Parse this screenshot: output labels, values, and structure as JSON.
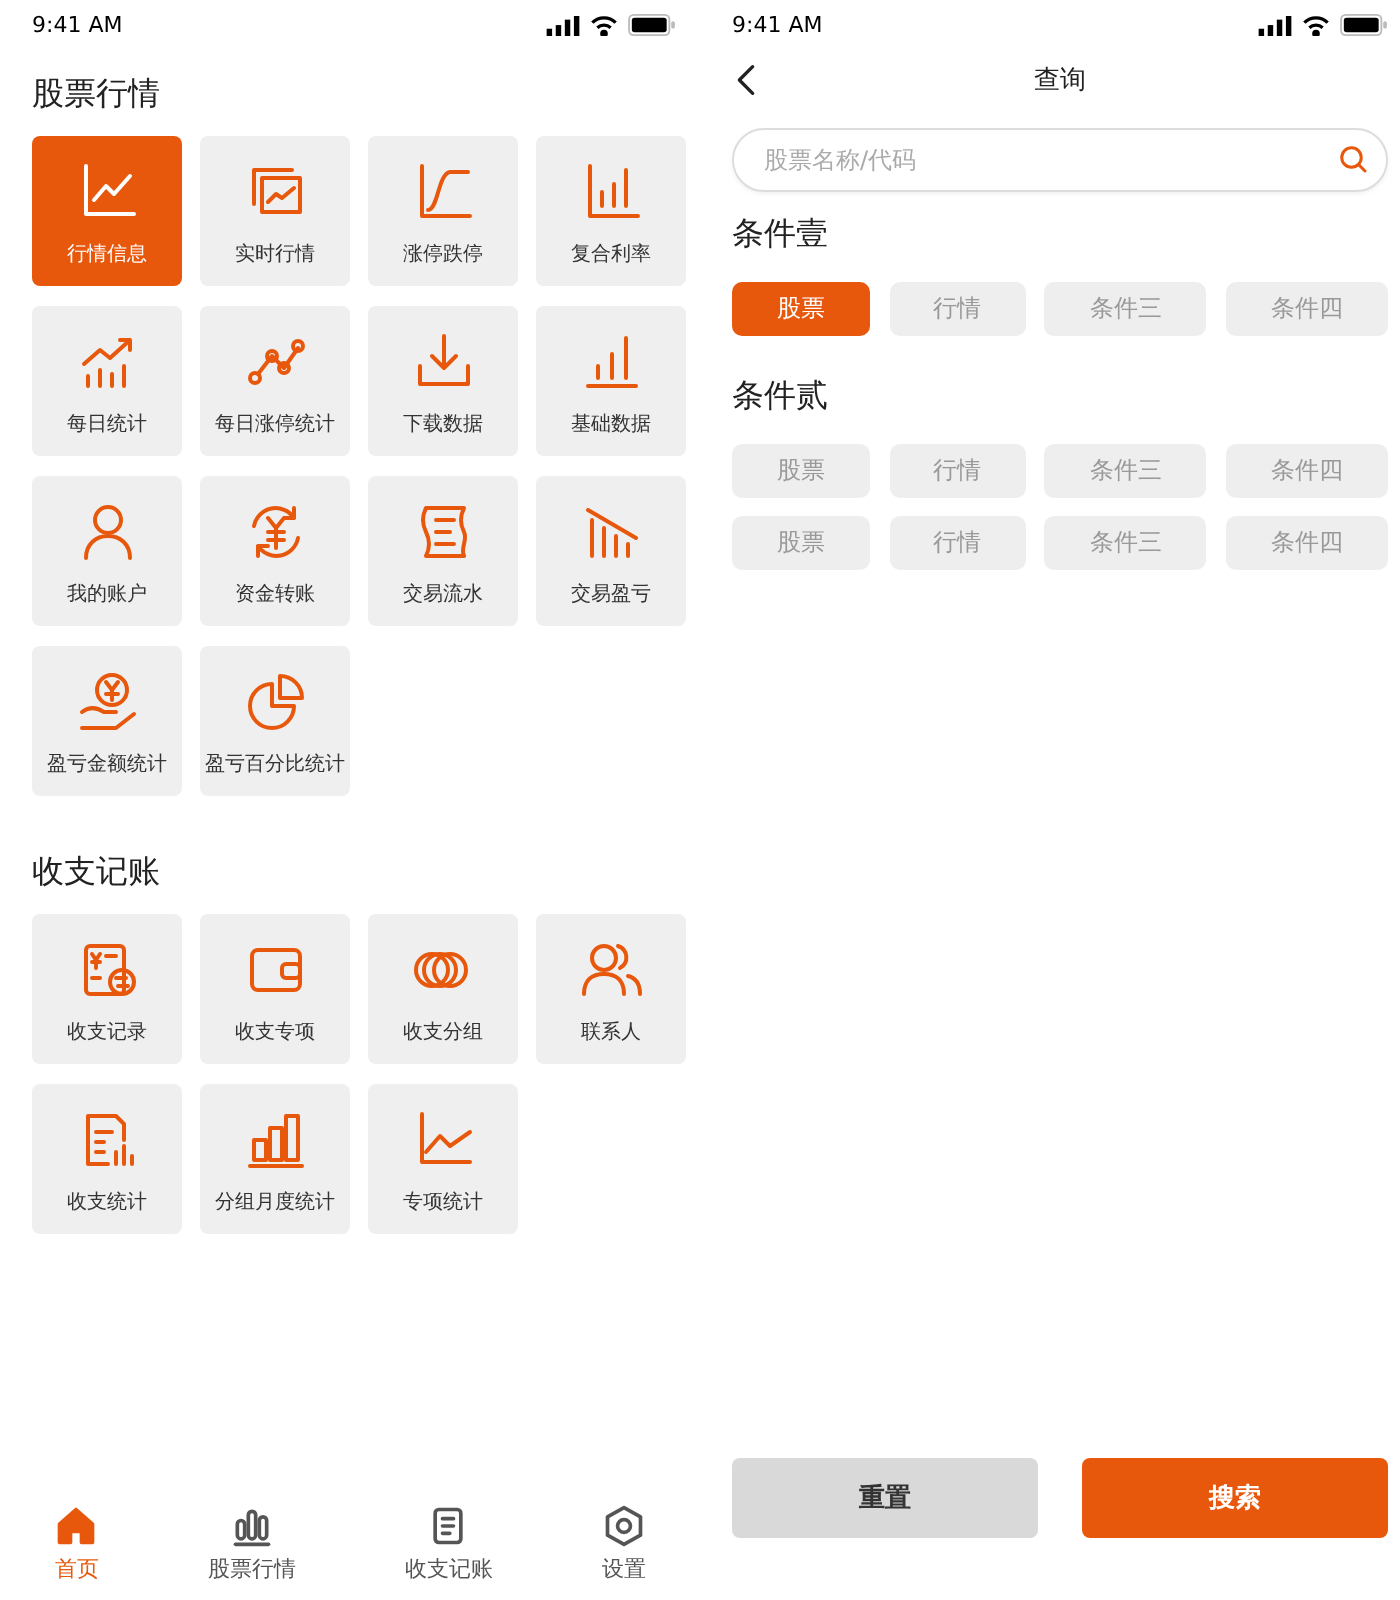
{
  "home": {
    "status_bar": {
      "time": "9:41 AM"
    },
    "sections": [
      {
        "title": "股票行情",
        "tiles": [
          {
            "label": "行情信息",
            "selected": true
          },
          {
            "label": "实时行情",
            "selected": false
          },
          {
            "label": "涨停跌停",
            "selected": false
          },
          {
            "label": "复合利率",
            "selected": false
          },
          {
            "label": "每日统计",
            "selected": false
          },
          {
            "label": "每日涨停统计",
            "selected": false
          },
          {
            "label": "下载数据",
            "selected": false
          },
          {
            "label": "基础数据",
            "selected": false
          },
          {
            "label": "我的账户",
            "selected": false
          },
          {
            "label": "资金转账",
            "selected": false
          },
          {
            "label": "交易流水",
            "selected": false
          },
          {
            "label": "交易盈亏",
            "selected": false
          },
          {
            "label": "盈亏金额统计",
            "selected": false
          },
          {
            "label": "盈亏百分比统计",
            "selected": false
          }
        ]
      },
      {
        "title": "收支记账",
        "tiles": [
          {
            "label": "收支记录",
            "selected": false
          },
          {
            "label": "收支专项",
            "selected": false
          },
          {
            "label": "收支分组",
            "selected": false
          },
          {
            "label": "联系人",
            "selected": false
          },
          {
            "label": "收支统计",
            "selected": false
          },
          {
            "label": "分组月度统计",
            "selected": false
          },
          {
            "label": "专项统计",
            "selected": false
          }
        ]
      }
    ],
    "tab_bar": [
      {
        "label": "首页",
        "selected": true
      },
      {
        "label": "股票行情",
        "selected": false
      },
      {
        "label": "收支记账",
        "selected": false
      },
      {
        "label": "设置",
        "selected": false
      }
    ]
  },
  "query": {
    "status_bar": {
      "time": "9:41 AM"
    },
    "title": "查询",
    "search": {
      "placeholder": "股票名称/代码"
    },
    "groups": [
      {
        "title": "条件壹",
        "rows": [
          {
            "chips": [
              {
                "label": "股票",
                "selected": true
              },
              {
                "label": "行情",
                "selected": false
              },
              {
                "label": "条件三",
                "selected": false
              },
              {
                "label": "条件四",
                "selected": false
              }
            ]
          }
        ]
      },
      {
        "title": "条件贰",
        "rows": [
          {
            "chips": [
              {
                "label": "股票",
                "selected": false
              },
              {
                "label": "行情",
                "selected": false
              },
              {
                "label": "条件三",
                "selected": false
              },
              {
                "label": "条件四",
                "selected": false
              }
            ]
          },
          {
            "chips": [
              {
                "label": "股票",
                "selected": false
              },
              {
                "label": "行情",
                "selected": false
              },
              {
                "label": "条件三",
                "selected": false
              },
              {
                "label": "条件四",
                "selected": false
              }
            ]
          }
        ]
      }
    ],
    "buttons": [
      {
        "label": "重置",
        "kind": "secondary"
      },
      {
        "label": "搜索",
        "kind": "primary"
      }
    ]
  }
}
